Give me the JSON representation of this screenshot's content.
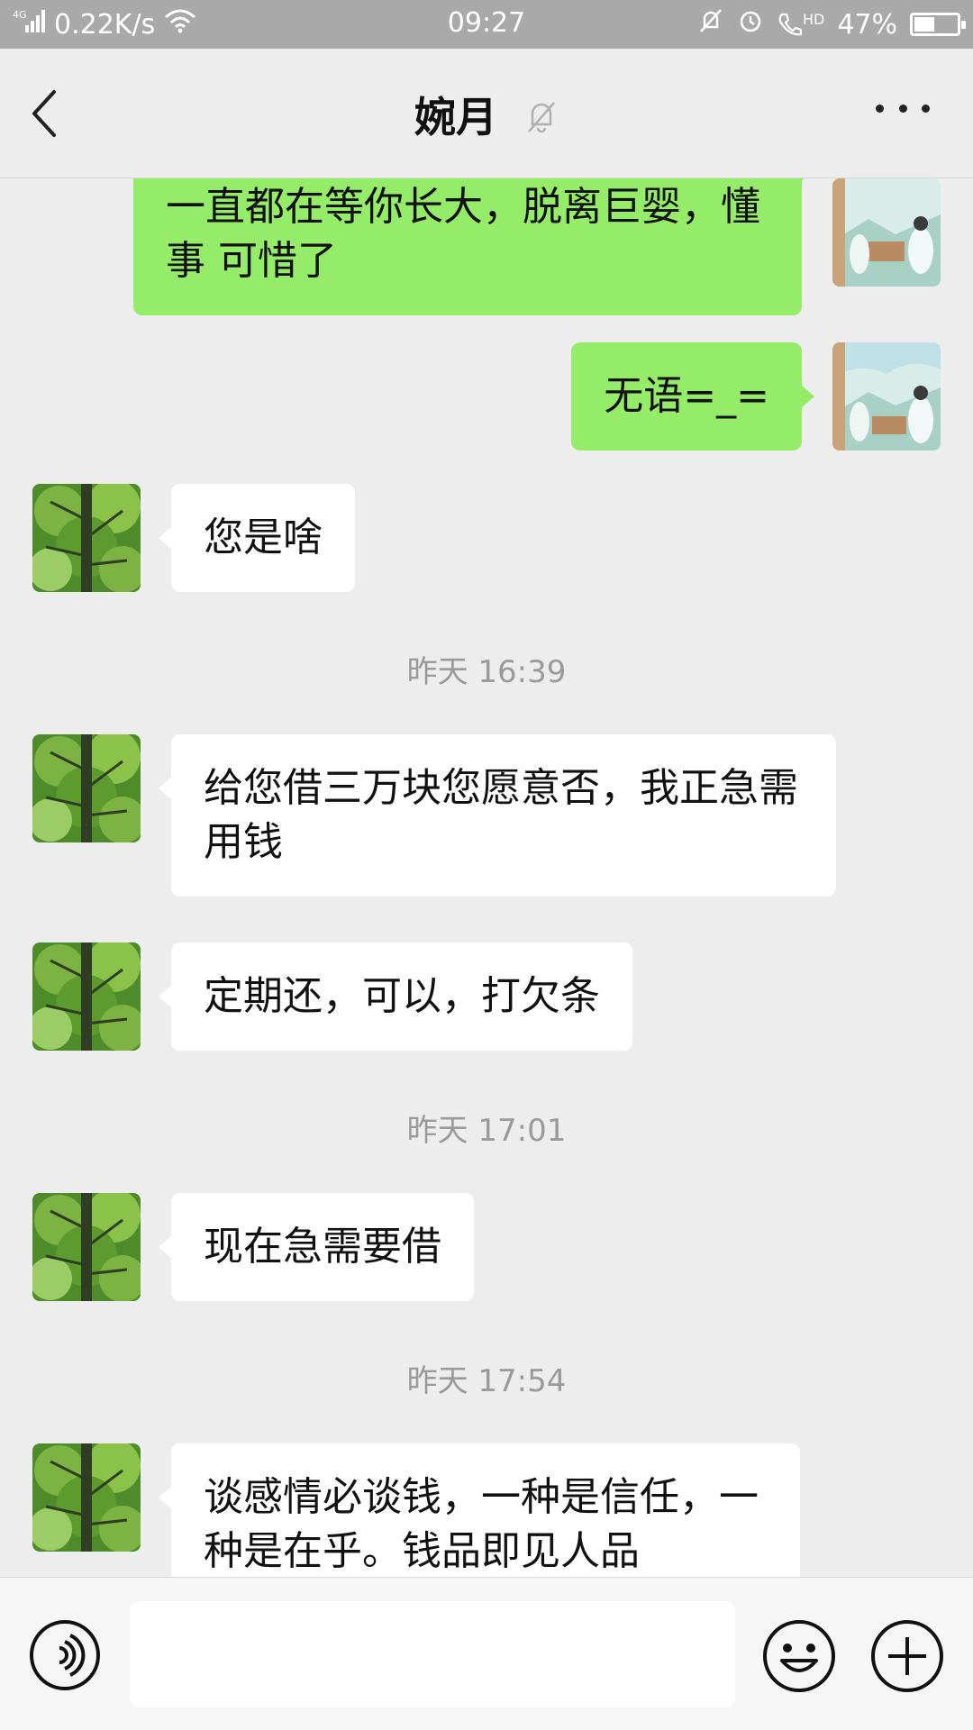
{
  "status_bar": {
    "network": "4G",
    "speed": "0.22K/s",
    "time": "09:27",
    "hd": "HD",
    "battery": "47%",
    "battery_level": 0.47
  },
  "header": {
    "title": "婉月",
    "muted": true
  },
  "messages": [
    {
      "kind": "msg",
      "dir": "out",
      "text": "一直都在等你长大，脱离巨婴，懂事 可惜了"
    },
    {
      "kind": "msg",
      "dir": "out",
      "text": "无语=_="
    },
    {
      "kind": "msg",
      "dir": "in",
      "text": "您是啥"
    },
    {
      "kind": "time",
      "text": "昨天 16:39"
    },
    {
      "kind": "msg",
      "dir": "in",
      "text": "给您借三万块您愿意否，我正急需用钱"
    },
    {
      "kind": "msg",
      "dir": "in",
      "text": "定期还，可以，打欠条"
    },
    {
      "kind": "time",
      "text": "昨天 17:01"
    },
    {
      "kind": "msg",
      "dir": "in",
      "text": "现在急需要借"
    },
    {
      "kind": "time",
      "text": "昨天 17:54"
    },
    {
      "kind": "msg",
      "dir": "in",
      "text": "谈感情必谈钱，一种是信任，一种是在乎。钱品即见人品"
    }
  ],
  "input": {
    "placeholder": ""
  },
  "colors": {
    "background": "#ededed",
    "outgoing_bubble": "#95ec69",
    "incoming_bubble": "#ffffff",
    "status_bar": "#a9a9a9"
  },
  "icons": [
    "back-icon",
    "mute-bell-icon",
    "more-icon",
    "voice-icon",
    "emoji-icon",
    "plus-icon"
  ]
}
